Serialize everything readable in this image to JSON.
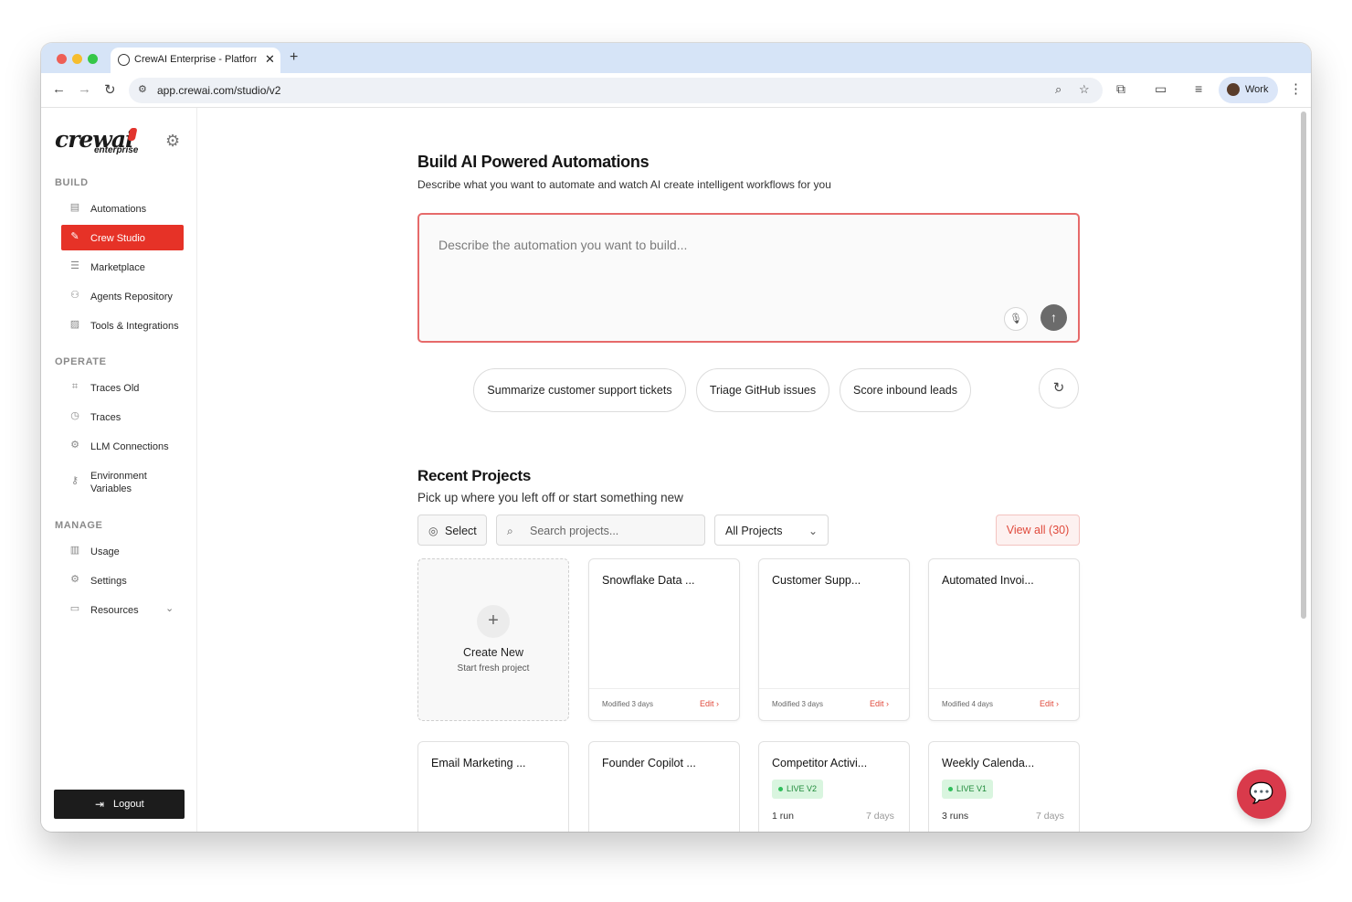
{
  "browser": {
    "tab_title": "CrewAI Enterprise - Platform",
    "tab_close": "✕",
    "new_tab": "+",
    "url": "app.crewai.com/studio/v2",
    "profile_name": "Work",
    "traffic_colors": [
      "#ee5f56",
      "#f6bd2e",
      "#35c748"
    ]
  },
  "sidebar": {
    "logo_text": "crewai",
    "logo_sub": "enterprise",
    "build_label": "BUILD",
    "build_items": [
      {
        "label": "Automations",
        "icon": "chart-icon"
      },
      {
        "label": "Crew Studio",
        "icon": "edit-icon",
        "active": true
      },
      {
        "label": "Marketplace",
        "icon": "database-icon"
      },
      {
        "label": "Agents Repository",
        "icon": "users-icon"
      },
      {
        "label": "Tools & Integrations",
        "icon": "image-icon"
      }
    ],
    "operate_label": "OPERATE",
    "operate_items": [
      {
        "label": "Traces Old",
        "icon": "scan-icon"
      },
      {
        "label": "Traces",
        "icon": "clock-icon"
      },
      {
        "label": "LLM Connections",
        "icon": "link-icon"
      },
      {
        "label": "Environment Variables",
        "icon": "key-icon"
      }
    ],
    "manage_label": "MANAGE",
    "manage_items": [
      {
        "label": "Usage",
        "icon": "bar-chart-icon"
      },
      {
        "label": "Settings",
        "icon": "gear-icon"
      },
      {
        "label": "Resources",
        "icon": "folder-icon"
      }
    ],
    "logout_label": "Logout"
  },
  "main": {
    "title": "Build AI Powered Automations",
    "subtitle": "Describe what you want to automate and watch AI create intelligent workflows for you",
    "prompt_placeholder": "Describe the automation you want to build...",
    "suggestions": [
      "Summarize customer support tickets",
      "Triage GitHub issues",
      "Score inbound leads"
    ],
    "recent_title": "Recent Projects",
    "recent_subtitle": "Pick up where you left off or start something new",
    "select_label": "Select",
    "search_placeholder": "Search projects...",
    "filter_value": "All Projects",
    "view_all": "View all (30)",
    "create_new": "Create New",
    "create_sub": "Start fresh project",
    "projects": [
      {
        "name": "Snowflake Data ...",
        "modified": "Modified 3 days",
        "edit": "Edit"
      },
      {
        "name": "Customer Supp...",
        "modified": "Modified 3 days",
        "edit": "Edit"
      },
      {
        "name": "Automated Invoi...",
        "modified": "Modified 4 days",
        "edit": "Edit"
      }
    ],
    "projects_row2": [
      {
        "name": "Email Marketing ..."
      },
      {
        "name": "Founder Copilot ..."
      },
      {
        "name": "Competitor Activi...",
        "badge": "LIVE V2",
        "runs": "1 run",
        "age": "7 days"
      },
      {
        "name": "Weekly Calenda...",
        "badge": "LIVE V1",
        "runs": "3 runs",
        "age": "7 days"
      }
    ]
  },
  "colors": {
    "accent": "#e63227",
    "live_badge": "#d9f5df",
    "chat_fab": "#d93a4b"
  }
}
